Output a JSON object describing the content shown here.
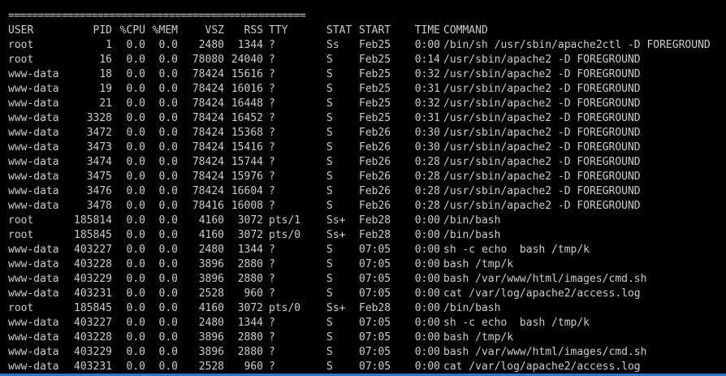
{
  "separator": "==================================================",
  "header": {
    "user": "USER",
    "pid": "PID",
    "cpu": "%CPU",
    "mem": "%MEM",
    "vsz": "VSZ",
    "rss": "RSS",
    "tty": "TTY",
    "stat": "STAT",
    "start": "START",
    "time": "TIME",
    "command": "COMMAND"
  },
  "rows": [
    {
      "user": "root",
      "pid": "1",
      "cpu": "0.0",
      "mem": "0.0",
      "vsz": "2480",
      "rss": "1344",
      "tty": "?",
      "stat": "Ss",
      "start": "Feb25",
      "time": "0:00",
      "command": "/bin/sh /usr/sbin/apache2ctl -D FOREGROUND"
    },
    {
      "user": "root",
      "pid": "16",
      "cpu": "0.0",
      "mem": "0.0",
      "vsz": "78080",
      "rss": "24040",
      "tty": "?",
      "stat": "S",
      "start": "Feb25",
      "time": "0:14",
      "command": "/usr/sbin/apache2 -D FOREGROUND"
    },
    {
      "user": "www-data",
      "pid": "18",
      "cpu": "0.0",
      "mem": "0.0",
      "vsz": "78424",
      "rss": "15616",
      "tty": "?",
      "stat": "S",
      "start": "Feb25",
      "time": "0:32",
      "command": "/usr/sbin/apache2 -D FOREGROUND"
    },
    {
      "user": "www-data",
      "pid": "19",
      "cpu": "0.0",
      "mem": "0.0",
      "vsz": "78424",
      "rss": "16016",
      "tty": "?",
      "stat": "S",
      "start": "Feb25",
      "time": "0:31",
      "command": "/usr/sbin/apache2 -D FOREGROUND"
    },
    {
      "user": "www-data",
      "pid": "21",
      "cpu": "0.0",
      "mem": "0.0",
      "vsz": "78424",
      "rss": "16448",
      "tty": "?",
      "stat": "S",
      "start": "Feb25",
      "time": "0:32",
      "command": "/usr/sbin/apache2 -D FOREGROUND"
    },
    {
      "user": "www-data",
      "pid": "3328",
      "cpu": "0.0",
      "mem": "0.0",
      "vsz": "78424",
      "rss": "16452",
      "tty": "?",
      "stat": "S",
      "start": "Feb25",
      "time": "0:31",
      "command": "/usr/sbin/apache2 -D FOREGROUND"
    },
    {
      "user": "www-data",
      "pid": "3472",
      "cpu": "0.0",
      "mem": "0.0",
      "vsz": "78424",
      "rss": "15368",
      "tty": "?",
      "stat": "S",
      "start": "Feb26",
      "time": "0:30",
      "command": "/usr/sbin/apache2 -D FOREGROUND"
    },
    {
      "user": "www-data",
      "pid": "3473",
      "cpu": "0.0",
      "mem": "0.0",
      "vsz": "78424",
      "rss": "15416",
      "tty": "?",
      "stat": "S",
      "start": "Feb26",
      "time": "0:30",
      "command": "/usr/sbin/apache2 -D FOREGROUND"
    },
    {
      "user": "www-data",
      "pid": "3474",
      "cpu": "0.0",
      "mem": "0.0",
      "vsz": "78424",
      "rss": "15744",
      "tty": "?",
      "stat": "S",
      "start": "Feb26",
      "time": "0:28",
      "command": "/usr/sbin/apache2 -D FOREGROUND"
    },
    {
      "user": "www-data",
      "pid": "3475",
      "cpu": "0.0",
      "mem": "0.0",
      "vsz": "78424",
      "rss": "15976",
      "tty": "?",
      "stat": "S",
      "start": "Feb26",
      "time": "0:28",
      "command": "/usr/sbin/apache2 -D FOREGROUND"
    },
    {
      "user": "www-data",
      "pid": "3476",
      "cpu": "0.0",
      "mem": "0.0",
      "vsz": "78424",
      "rss": "16604",
      "tty": "?",
      "stat": "S",
      "start": "Feb26",
      "time": "0:28",
      "command": "/usr/sbin/apache2 -D FOREGROUND"
    },
    {
      "user": "www-data",
      "pid": "3478",
      "cpu": "0.0",
      "mem": "0.0",
      "vsz": "78416",
      "rss": "16008",
      "tty": "?",
      "stat": "S",
      "start": "Feb26",
      "time": "0:28",
      "command": "/usr/sbin/apache2 -D FOREGROUND"
    },
    {
      "user": "root",
      "pid": "185814",
      "cpu": "0.0",
      "mem": "0.0",
      "vsz": "4160",
      "rss": "3072",
      "tty": "pts/1",
      "stat": "Ss+",
      "start": "Feb28",
      "time": "0:00",
      "command": "/bin/bash"
    },
    {
      "user": "root",
      "pid": "185845",
      "cpu": "0.0",
      "mem": "0.0",
      "vsz": "4160",
      "rss": "3072",
      "tty": "pts/0",
      "stat": "Ss+",
      "start": "Feb28",
      "time": "0:00",
      "command": "/bin/bash"
    },
    {
      "user": "www-data",
      "pid": "403227",
      "cpu": "0.0",
      "mem": "0.0",
      "vsz": "2480",
      "rss": "1344",
      "tty": "?",
      "stat": "S",
      "start": "07:05",
      "time": "0:00",
      "command": "sh -c echo  bash /tmp/k"
    },
    {
      "user": "www-data",
      "pid": "403228",
      "cpu": "0.0",
      "mem": "0.0",
      "vsz": "3896",
      "rss": "2880",
      "tty": "?",
      "stat": "S",
      "start": "07:05",
      "time": "0:00",
      "command": "bash /tmp/k"
    },
    {
      "user": "www-data",
      "pid": "403229",
      "cpu": "0.0",
      "mem": "0.0",
      "vsz": "3896",
      "rss": "2880",
      "tty": "?",
      "stat": "S",
      "start": "07:05",
      "time": "0:00",
      "command": "bash /var/www/html/images/cmd.sh"
    },
    {
      "user": "www-data",
      "pid": "403231",
      "cpu": "0.0",
      "mem": "0.0",
      "vsz": "2528",
      "rss": "960",
      "tty": "?",
      "stat": "S",
      "start": "07:05",
      "time": "0:00",
      "command": "cat /var/log/apache2/access.log"
    },
    {
      "user": "root",
      "pid": "185845",
      "cpu": "0.0",
      "mem": "0.0",
      "vsz": "4160",
      "rss": "3072",
      "tty": "pts/0",
      "stat": "Ss+",
      "start": "Feb28",
      "time": "0:00",
      "command": "/bin/bash"
    },
    {
      "user": "www-data",
      "pid": "403227",
      "cpu": "0.0",
      "mem": "0.0",
      "vsz": "2480",
      "rss": "1344",
      "tty": "?",
      "stat": "S",
      "start": "07:05",
      "time": "0:00",
      "command": "sh -c echo  bash /tmp/k"
    },
    {
      "user": "www-data",
      "pid": "403228",
      "cpu": "0.0",
      "mem": "0.0",
      "vsz": "3896",
      "rss": "2880",
      "tty": "?",
      "stat": "S",
      "start": "07:05",
      "time": "0:00",
      "command": "bash /tmp/k"
    },
    {
      "user": "www-data",
      "pid": "403229",
      "cpu": "0.0",
      "mem": "0.0",
      "vsz": "3896",
      "rss": "2880",
      "tty": "?",
      "stat": "S",
      "start": "07:05",
      "time": "0:00",
      "command": "bash /var/www/html/images/cmd.sh"
    },
    {
      "user": "www-data",
      "pid": "403231",
      "cpu": "0.0",
      "mem": "0.0",
      "vsz": "2528",
      "rss": "960",
      "tty": "?",
      "stat": "S",
      "start": "07:05",
      "time": "0:00",
      "command": "cat /var/log/apache2/access.log"
    }
  ],
  "colors": {
    "background": "#000000",
    "text": "#cccccc",
    "status_bar": "#2b79c2"
  }
}
